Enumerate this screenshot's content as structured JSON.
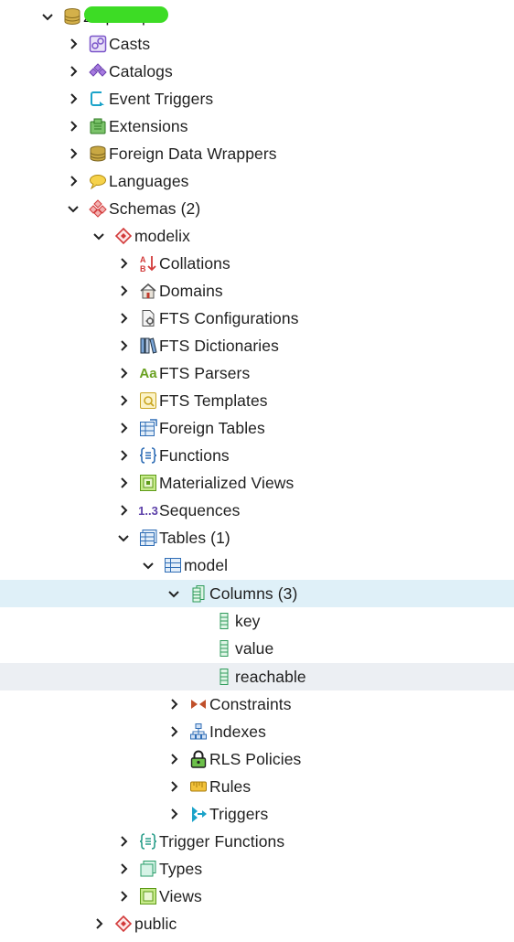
{
  "tree": {
    "server": "zuqueriqo",
    "casts": "Casts",
    "catalogs": "Catalogs",
    "event_triggers": "Event Triggers",
    "extensions": "Extensions",
    "foreign_data_wrappers": "Foreign Data Wrappers",
    "languages": "Languages",
    "schemas": "Schemas (2)",
    "modelix": "modelix",
    "collations": "Collations",
    "domains": "Domains",
    "fts_configurations": "FTS Configurations",
    "fts_dictionaries": "FTS Dictionaries",
    "fts_parsers": "FTS Parsers",
    "fts_templates": "FTS Templates",
    "foreign_tables": "Foreign Tables",
    "functions": "Functions",
    "materialized_views": "Materialized Views",
    "sequences": "Sequences",
    "tables": "Tables (1)",
    "model": "model",
    "columns": "Columns (3)",
    "col_key": "key",
    "col_value": "value",
    "col_reachable": "reachable",
    "constraints": "Constraints",
    "indexes": "Indexes",
    "rls_policies": "RLS Policies",
    "rules": "Rules",
    "triggers": "Triggers",
    "trigger_functions": "Trigger Functions",
    "types": "Types",
    "views": "Views",
    "public": "public"
  },
  "icons": {
    "sequences_glyph": "1..3",
    "fts_parsers_glyph": "Aa"
  },
  "colors": {
    "selection": "#dff0f8",
    "hover": "#eceff3",
    "redaction": "#3ddc25"
  }
}
